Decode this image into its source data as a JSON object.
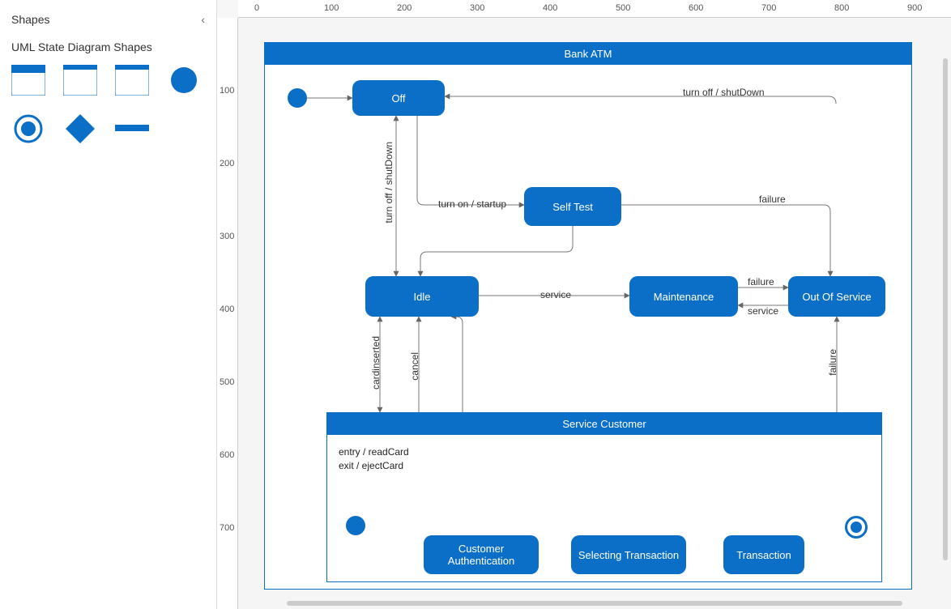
{
  "sidebar": {
    "title": "Shapes",
    "group_title": "UML State Diagram Shapes"
  },
  "ruler": {
    "h": [
      "0",
      "100",
      "200",
      "300",
      "400",
      "500",
      "600",
      "700",
      "800",
      "900"
    ],
    "v": [
      "100",
      "200",
      "300",
      "400",
      "500",
      "600",
      "700"
    ]
  },
  "diagram": {
    "title": "Bank ATM",
    "nodes": {
      "off": "Off",
      "selftest": "Self Test",
      "idle": "Idle",
      "maintenance": "Maintenance",
      "outofservice": "Out Of Service"
    },
    "service_customer": {
      "title": "Service Customer",
      "entry": [
        "entry / readCard",
        "exit / ejectCard"
      ],
      "nodes": {
        "auth": "Customer Authentication",
        "select": "Selecting Transaction",
        "trans": "Transaction"
      }
    },
    "edges": {
      "turnoff": "turn off / shutDown",
      "turnon": "turn on / startup",
      "turnoff_v": "turn off / shutDown",
      "failure1": "failure",
      "service": "service",
      "failure2": "failure",
      "service2": "service",
      "failure3": "failure",
      "cardinserted": "cardinserted",
      "cancel": "cancel"
    }
  }
}
